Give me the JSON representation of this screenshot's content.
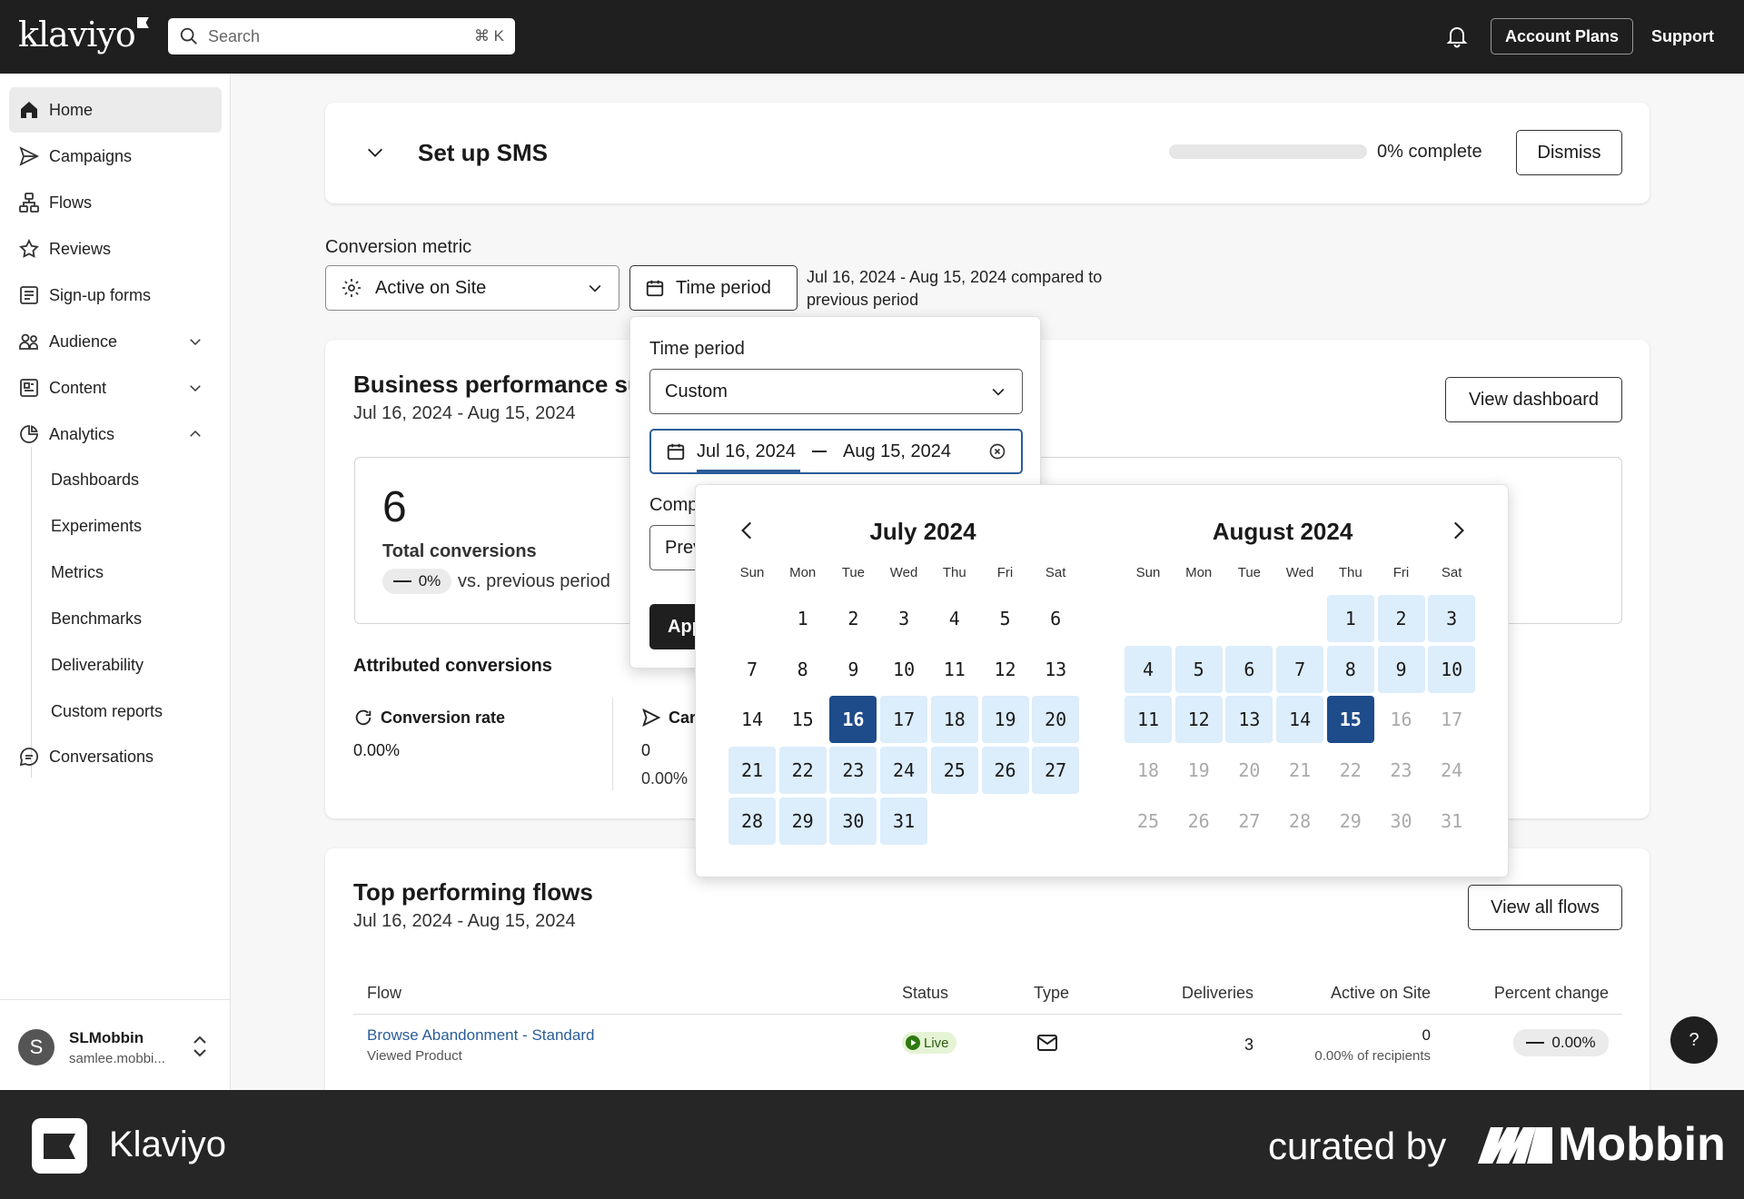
{
  "topbar": {
    "logo": "klaviyo",
    "search_placeholder": "Search",
    "search_shortcut": "⌘ K",
    "account_plans": "Account Plans",
    "support": "Support"
  },
  "sidebar": {
    "items": [
      {
        "label": "Home"
      },
      {
        "label": "Campaigns"
      },
      {
        "label": "Flows"
      },
      {
        "label": "Reviews"
      },
      {
        "label": "Sign-up forms"
      },
      {
        "label": "Audience"
      },
      {
        "label": "Content"
      },
      {
        "label": "Analytics"
      },
      {
        "label": "Conversations"
      }
    ],
    "analytics_sub": [
      "Dashboards",
      "Experiments",
      "Metrics",
      "Benchmarks",
      "Deliverability",
      "Custom reports"
    ],
    "user": {
      "initial": "S",
      "name": "SLMobbin",
      "email": "samlee.mobbi..."
    }
  },
  "setup": {
    "title": "Set up SMS",
    "progress_text": "0% complete",
    "progress_value": 0,
    "dismiss": "Dismiss"
  },
  "filters": {
    "metric_label": "Conversion metric",
    "metric_value": "Active on Site",
    "time_button": "Time period",
    "range_text_1": "Jul 16, 2024 - Aug 15, 2024 compared to",
    "range_text_2": "previous period"
  },
  "popover": {
    "label": "Time period",
    "select_value": "Custom",
    "start_date": "Jul 16, 2024",
    "end_date": "Aug 15, 2024",
    "compare_label_partial": "Comp",
    "compare_value_partial": "Prev",
    "apply_partial": "App"
  },
  "calendar": {
    "left_month": "July 2024",
    "right_month": "August 2024",
    "weekdays": [
      "Sun",
      "Mon",
      "Tue",
      "Wed",
      "Thu",
      "Fri",
      "Sat"
    ],
    "july_first_weekday": 1,
    "july_days": 31,
    "august_first_weekday": 4,
    "august_days": 31,
    "range_start": "2024-07-16",
    "range_end": "2024-08-15",
    "selected_color": "#1e4b8a",
    "range_color": "#dcedfb"
  },
  "business": {
    "title": "Business performance sur",
    "date": "Jul 16, 2024 - Aug 15, 2024",
    "view_dashboard": "View dashboard",
    "total_value": "6",
    "total_label": "Total conversions",
    "change": "0%",
    "vs_label": "vs. previous period",
    "attributed_label": "Attributed conversions",
    "conv_rate_label": "Conversion rate",
    "conv_rate_value": "0.00%",
    "camp_label_partial": "Car",
    "camp_value": "0",
    "camp_pct": "0.00%"
  },
  "flows": {
    "title": "Top performing flows",
    "date": "Jul 16, 2024 - Aug 15, 2024",
    "view_all": "View all flows",
    "headers": [
      "Flow",
      "Status",
      "Type",
      "Deliveries",
      "Active on Site",
      "Percent change"
    ],
    "rows": [
      {
        "name": "Browse Abandonment - Standard",
        "trigger": "Viewed Product",
        "status": "Live",
        "deliveries": "3",
        "active": "0",
        "active_pct": "0.00% of recipients",
        "change": "0.00%"
      }
    ]
  },
  "help_label": "?",
  "footer": {
    "app_name": "Klaviyo",
    "curated_by": "curated by",
    "brand": "Mobbin"
  }
}
